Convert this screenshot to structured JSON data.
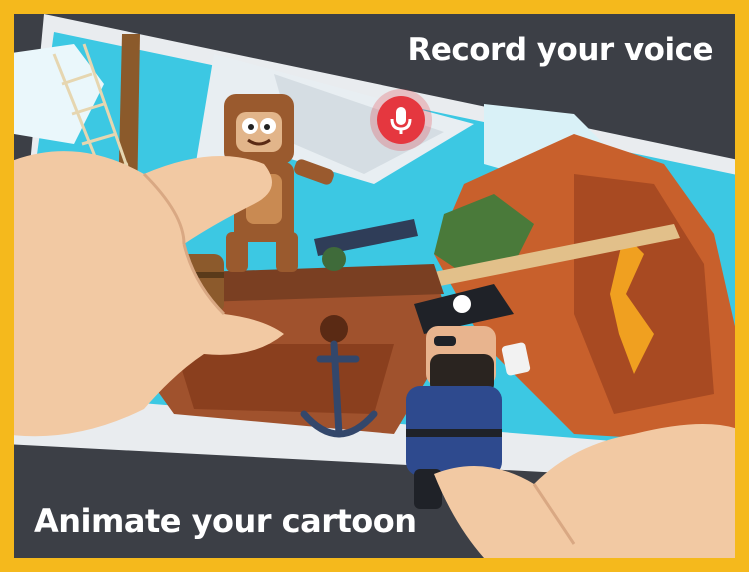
{
  "captions": {
    "top": "Record your voice",
    "bottom": "Animate your cartoon"
  },
  "icons": {
    "record": "microphone-icon",
    "flag": "skull-crossbones-icon"
  },
  "colors": {
    "border": "#f5b91c",
    "background": "#3c3f46",
    "record_button": "#e5373f",
    "sky": "#3cc8e3",
    "ship_wood": "#a0522d",
    "cliff": "#c8602c"
  }
}
